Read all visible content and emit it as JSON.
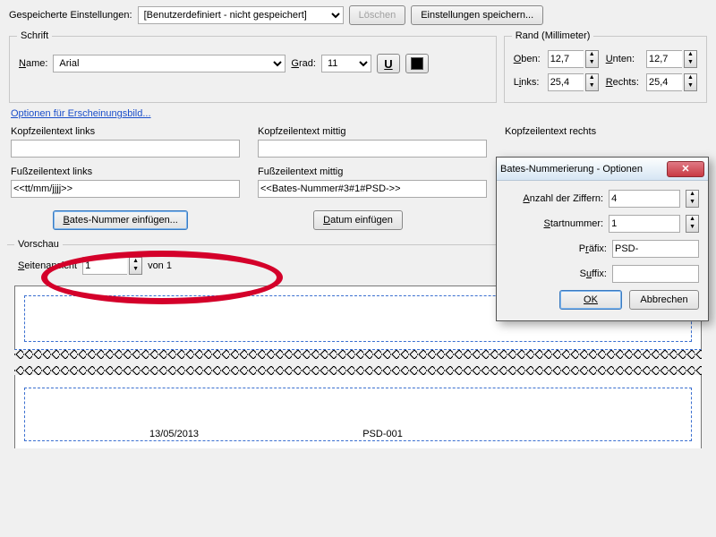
{
  "saved": {
    "label": "Gespeicherte Einstellungen:",
    "value": "[Benutzerdefiniert - nicht gespeichert]",
    "delete": "Löschen",
    "save": "Einstellungen speichern..."
  },
  "font": {
    "legend": "Schrift",
    "name_label": "Name:",
    "name_value": "Arial",
    "size_label": "Grad:",
    "size_value": "11",
    "underline": "U"
  },
  "margins": {
    "legend": "Rand (Millimeter)",
    "top_label": "Oben:",
    "top_value": "12,7",
    "bottom_label": "Unten:",
    "bottom_value": "12,7",
    "left_label": "Links:",
    "left_value": "25,4",
    "right_label": "Rechts:",
    "right_value": "25,4"
  },
  "appearance_link": "Optionen für Erscheinungsbild...",
  "headers": {
    "hl_label": "Kopfzeilentext links",
    "hc_label": "Kopfzeilentext mittig",
    "hr_label": "Kopfzeilentext rechts",
    "fl_label": "Fußzeilentext links",
    "fc_label": "Fußzeilentext mittig",
    "hl_value": "",
    "hc_value": "",
    "fl_value": "<<tt/mm/jjjj>>",
    "fc_value": "<<Bates-Nummer#3#1#PSD->>"
  },
  "buttons": {
    "insert_bates": "Bates-Nummer einfügen...",
    "insert_date": "Datum einfügen"
  },
  "preview": {
    "legend": "Vorschau",
    "pageview_label": "Seitenansicht",
    "page": "1",
    "of": "von 1",
    "date": "13/05/2013",
    "bates": "PSD-001"
  },
  "dialog": {
    "title": "Bates-Nummerierung - Optionen",
    "digits_label": "Anzahl der Ziffern:",
    "digits_value": "4",
    "start_label": "Startnummer:",
    "start_value": "1",
    "prefix_label": "Präfix:",
    "prefix_value": "PSD-",
    "suffix_label": "Suffix:",
    "suffix_value": "",
    "ok": "OK",
    "cancel": "Abbrechen"
  }
}
